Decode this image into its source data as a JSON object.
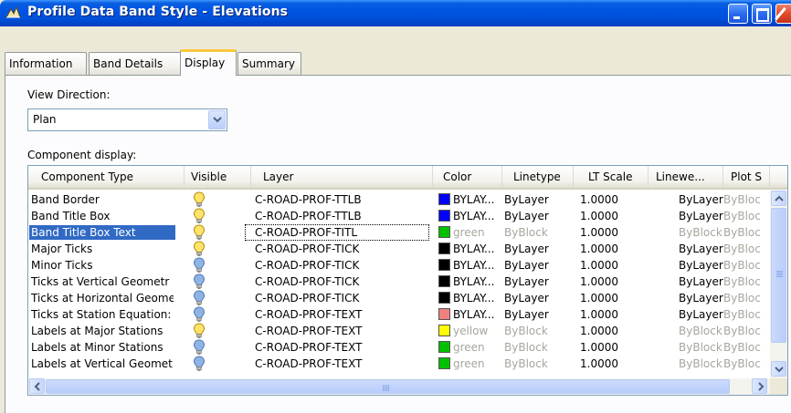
{
  "window": {
    "title": "Profile Data Band Style - Elevations"
  },
  "tabs": [
    {
      "label": "Information",
      "active": false
    },
    {
      "label": "Band Details",
      "active": false
    },
    {
      "label": "Display",
      "active": true
    },
    {
      "label": "Summary",
      "active": false
    }
  ],
  "view_direction": {
    "label": "View Direction:",
    "value": "Plan"
  },
  "component_display": {
    "label": "Component display:",
    "columns": [
      "Component Type",
      "Visible",
      "Layer",
      "Color",
      "Linetype",
      "LT Scale",
      "Linewe...",
      "Plot S"
    ],
    "rows": [
      {
        "type": "Band Border",
        "visible": true,
        "layer": "C-ROAD-PROF-TTLB",
        "color": "BYLAY...",
        "swatch": "#0000ff",
        "linetype": "ByLayer",
        "lt_scale": "1.0000",
        "lineweight": "ByLayer",
        "plot": "ByBloc",
        "selected": false,
        "color_dim": false,
        "linetype_dim": false,
        "lineweight_dim": false
      },
      {
        "type": "Band Title Box",
        "visible": true,
        "layer": "C-ROAD-PROF-TTLB",
        "color": "BYLAY...",
        "swatch": "#0000ff",
        "linetype": "ByLayer",
        "lt_scale": "1.0000",
        "lineweight": "ByLayer",
        "plot": "ByBloc",
        "selected": false,
        "color_dim": false,
        "linetype_dim": false,
        "lineweight_dim": false
      },
      {
        "type": "Band Title Box Text",
        "visible": true,
        "layer": "C-ROAD-PROF-TITL",
        "color": "green",
        "swatch": "#00c000",
        "linetype": "ByBlock",
        "lt_scale": "1.0000",
        "lineweight": "ByBlock",
        "plot": "ByBloc",
        "selected": true,
        "color_dim": true,
        "linetype_dim": true,
        "lineweight_dim": true
      },
      {
        "type": "Major Ticks",
        "visible": true,
        "layer": "C-ROAD-PROF-TICK",
        "color": "BYLAY...",
        "swatch": "#000000",
        "linetype": "ByLayer",
        "lt_scale": "1.0000",
        "lineweight": "ByLayer",
        "plot": "ByBloc",
        "selected": false,
        "color_dim": false,
        "linetype_dim": false,
        "lineweight_dim": false
      },
      {
        "type": "Minor Ticks",
        "visible": false,
        "layer": "C-ROAD-PROF-TICK",
        "color": "BYLAY...",
        "swatch": "#000000",
        "linetype": "ByLayer",
        "lt_scale": "1.0000",
        "lineweight": "ByLayer",
        "plot": "ByBloc",
        "selected": false,
        "color_dim": false,
        "linetype_dim": false,
        "lineweight_dim": false
      },
      {
        "type": "Ticks at Vertical Geometr",
        "visible": false,
        "layer": "C-ROAD-PROF-TICK",
        "color": "BYLAY...",
        "swatch": "#000000",
        "linetype": "ByLayer",
        "lt_scale": "1.0000",
        "lineweight": "ByLayer",
        "plot": "ByBloc",
        "selected": false,
        "color_dim": false,
        "linetype_dim": false,
        "lineweight_dim": false
      },
      {
        "type": "Ticks at Horizontal Geome",
        "visible": false,
        "layer": "C-ROAD-PROF-TICK",
        "color": "BYLAY...",
        "swatch": "#000000",
        "linetype": "ByLayer",
        "lt_scale": "1.0000",
        "lineweight": "ByLayer",
        "plot": "ByBloc",
        "selected": false,
        "color_dim": false,
        "linetype_dim": false,
        "lineweight_dim": false
      },
      {
        "type": "Ticks at Station Equation:",
        "visible": false,
        "layer": "C-ROAD-PROF-TEXT",
        "color": "BYLAY...",
        "swatch": "#f08080",
        "linetype": "ByLayer",
        "lt_scale": "1.0000",
        "lineweight": "ByLayer",
        "plot": "ByBloc",
        "selected": false,
        "color_dim": false,
        "linetype_dim": false,
        "lineweight_dim": false
      },
      {
        "type": "Labels at Major Stations",
        "visible": true,
        "layer": "C-ROAD-PROF-TEXT",
        "color": "yellow",
        "swatch": "#ffff00",
        "linetype": "ByBlock",
        "lt_scale": "1.0000",
        "lineweight": "ByBlock",
        "plot": "ByBloc",
        "selected": false,
        "color_dim": true,
        "linetype_dim": true,
        "lineweight_dim": true
      },
      {
        "type": "Labels at Minor Stations",
        "visible": false,
        "layer": "C-ROAD-PROF-TEXT",
        "color": "green",
        "swatch": "#00c000",
        "linetype": "ByBlock",
        "lt_scale": "1.0000",
        "lineweight": "ByBlock",
        "plot": "ByBloc",
        "selected": false,
        "color_dim": true,
        "linetype_dim": true,
        "lineweight_dim": true
      },
      {
        "type": "Labels at Vertical Geomet",
        "visible": false,
        "layer": "C-ROAD-PROF-TEXT",
        "color": "green",
        "swatch": "#00c000",
        "linetype": "ByBlock",
        "lt_scale": "1.0000",
        "lineweight": "ByBlock",
        "plot": "ByBloc",
        "selected": false,
        "color_dim": true,
        "linetype_dim": true,
        "lineweight_dim": true
      }
    ]
  },
  "colors": {
    "title_bar": "#0054e3",
    "selection": "#316ac5",
    "bulb_on": "#ffe36b",
    "bulb_off": "#8fb4e3",
    "tab_highlight": "#ffc83c"
  },
  "icons": {
    "app": "profile-style-icon",
    "minimize": "minimize-icon",
    "maximize": "maximize-icon",
    "close": "close-icon",
    "dropdown": "chevron-down-icon",
    "bulb_on": "lightbulb-on-icon",
    "bulb_off": "lightbulb-off-icon"
  }
}
